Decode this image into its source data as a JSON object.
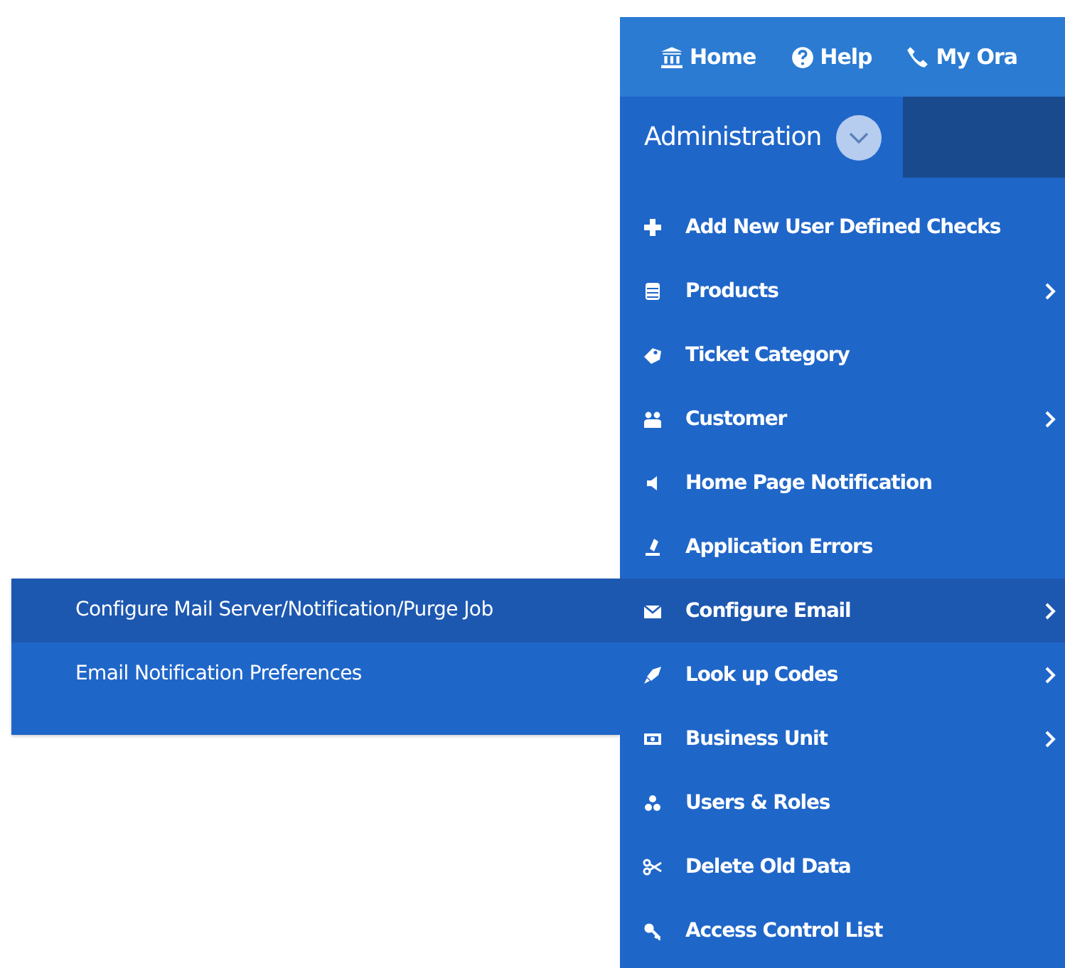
{
  "top_nav": [
    {
      "label": "Home"
    },
    {
      "label": "Help"
    },
    {
      "label": "My Ora"
    }
  ],
  "section": {
    "title": "Administration",
    "expanded": true
  },
  "menu": [
    {
      "label": "Add New User Defined Checks",
      "has_submenu": false,
      "selected": false
    },
    {
      "label": "Products",
      "has_submenu": true,
      "selected": false
    },
    {
      "label": "Ticket Category",
      "has_submenu": false,
      "selected": false
    },
    {
      "label": "Customer",
      "has_submenu": true,
      "selected": false
    },
    {
      "label": "Home Page Notification",
      "has_submenu": false,
      "selected": false
    },
    {
      "label": "Application Errors",
      "has_submenu": false,
      "selected": false
    },
    {
      "label": "Configure Email",
      "has_submenu": true,
      "selected": true
    },
    {
      "label": "Look up Codes",
      "has_submenu": true,
      "selected": false
    },
    {
      "label": "Business Unit",
      "has_submenu": true,
      "selected": false
    },
    {
      "label": "Users & Roles",
      "has_submenu": false,
      "selected": false
    },
    {
      "label": "Delete Old Data",
      "has_submenu": false,
      "selected": false
    },
    {
      "label": "Access Control List",
      "has_submenu": false,
      "selected": false
    }
  ],
  "submenu": [
    {
      "label": "Configure Mail Server/Notification/Purge Job",
      "selected": true
    },
    {
      "label": "Email Notification Preferences",
      "selected": false
    }
  ]
}
